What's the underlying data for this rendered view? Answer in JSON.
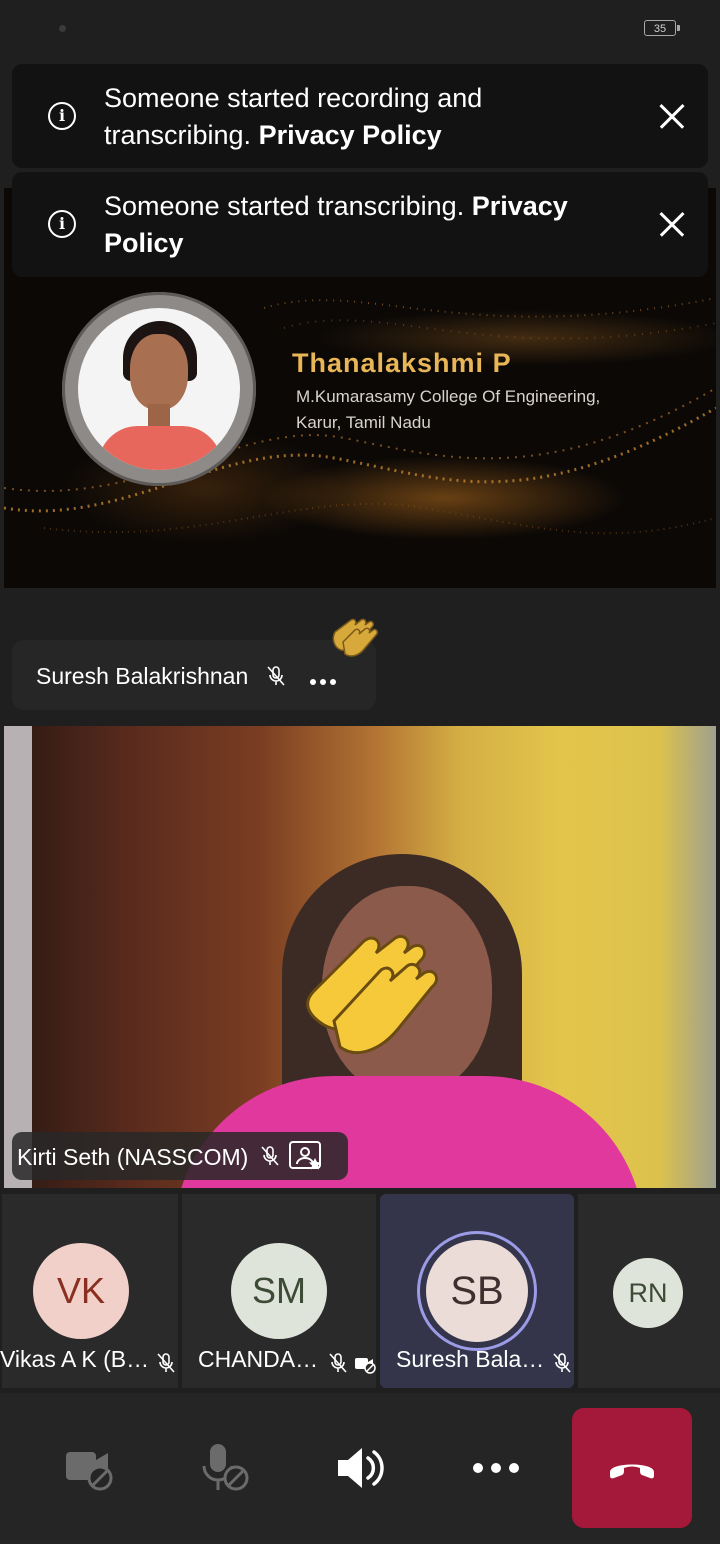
{
  "status_bar": {
    "battery": "35"
  },
  "banners": [
    {
      "text": "Someone started recording and transcribing. ",
      "link": "Privacy Policy"
    },
    {
      "text": "Someone started transcribing. ",
      "link": "Privacy Policy"
    }
  ],
  "presentation": {
    "speaker_name": "Thanalakshmi P",
    "line1": "M.Kumarasamy College Of Engineering,",
    "line2": "Karur, Tamil Nadu"
  },
  "raised_hand_participant": {
    "name": "Suresh Balakrishnan"
  },
  "video": {
    "participant_name": "Kirti Seth (NASSCOM)"
  },
  "participants": [
    {
      "initials": "VK",
      "name": "Vikas A K (B…"
    },
    {
      "initials": "SM",
      "name": "CHANDA…"
    },
    {
      "initials": "SB",
      "name": "Suresh Bala…"
    },
    {
      "initials": "RN",
      "name": ""
    }
  ],
  "colors": {
    "hangup": "#a4183a",
    "speaker_gold": "#e8b557",
    "active_ring": "#9b9be6"
  },
  "icons": [
    "info-icon",
    "close-icon",
    "mic-off-icon",
    "more-icon",
    "clap-icon",
    "presenter-icon",
    "camera-off-icon",
    "speaker-icon",
    "hang-up-icon",
    "camera-icon"
  ]
}
